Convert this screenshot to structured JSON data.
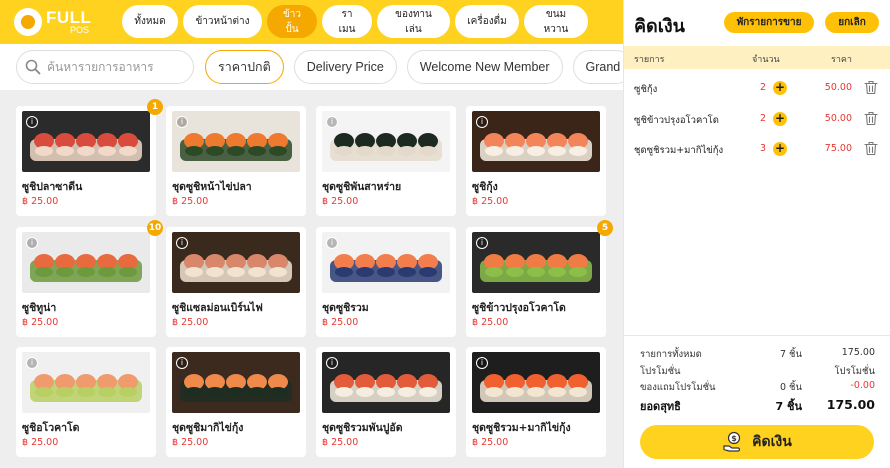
{
  "brand": {
    "name": "FULL",
    "sub": "POS"
  },
  "categories": [
    {
      "label": "ทั้งหมด",
      "active": false
    },
    {
      "label": "ข้าวหน้าต่าง",
      "active": false
    },
    {
      "label": "ข้าวปั้น",
      "active": true
    },
    {
      "label": "ราเมน",
      "active": false
    },
    {
      "label": "ของทานเล่น",
      "active": false
    },
    {
      "label": "เครื่องดื่ม",
      "active": false
    },
    {
      "label": "ขนมหวาน",
      "active": false
    }
  ],
  "search": {
    "placeholder": "ค้นหารายการอาหาร",
    "value": ""
  },
  "price_tabs": [
    {
      "label": "ราคาปกติ",
      "active": true
    },
    {
      "label": "Delivery Price",
      "active": false
    },
    {
      "label": "Welcome New Member",
      "active": false
    },
    {
      "label": "Grand",
      "active": false
    }
  ],
  "products": [
    {
      "name": "ซูชิปลาซาดีน",
      "price": "฿ 25.00",
      "badge": "1",
      "image": "sushi-sardine"
    },
    {
      "name": "ชุดซูชิหน้าไข่ปลา",
      "price": "฿ 25.00",
      "badge": "",
      "image": "sushi-roe"
    },
    {
      "name": "ชุดซูชิพันสาหร่าย",
      "price": "฿ 25.00",
      "badge": "",
      "image": "sushi-maki"
    },
    {
      "name": "ซูชิกุ้ง",
      "price": "฿ 25.00",
      "badge": "",
      "image": "sushi-shrimp"
    },
    {
      "name": "ซูชิทูน่า",
      "price": "฿ 25.00",
      "badge": "10",
      "image": "sushi-tuna"
    },
    {
      "name": "ซูชิแซลม่อนเบิร์นไฟ",
      "price": "฿ 25.00",
      "badge": "",
      "image": "sushi-salmon-seared"
    },
    {
      "name": "ชุดซูชิรวม",
      "price": "฿ 25.00",
      "badge": "",
      "image": "sushi-mixed"
    },
    {
      "name": "ซูชิข้าวปรุงอโวคาโด",
      "price": "฿ 25.00",
      "badge": "5",
      "image": "sushi-avocado-roll"
    },
    {
      "name": "ซูชิอโวคาโด",
      "price": "฿ 25.00",
      "badge": "",
      "image": "sushi-avocado"
    },
    {
      "name": "ชุดซูชิมากิไข่กุ้ง",
      "price": "฿ 25.00",
      "badge": "",
      "image": "sushi-maki-roe"
    },
    {
      "name": "ชุดซูชิรวมพันปูอัด",
      "price": "฿ 25.00",
      "badge": "",
      "image": "sushi-crab"
    },
    {
      "name": "ชุดซูชิรวม+มากิไข่กุ้ง",
      "price": "฿ 25.00",
      "badge": "",
      "image": "sushi-combo"
    }
  ],
  "order": {
    "title": "คิดเงิน",
    "hold_label": "พักรายการขาย",
    "cancel_label": "ยกเลิก",
    "col_item": "รายการ",
    "col_qty": "จำนวน",
    "col_price": "ราคา",
    "items": [
      {
        "name": "ซูชิกุ้ง",
        "qty": "2",
        "price": "50.00"
      },
      {
        "name": "ซูชิข้าวปรุงอโวคาโด",
        "qty": "2",
        "price": "50.00"
      },
      {
        "name": "ชุดซูชิรวม+มากิไข่กุ้ง",
        "qty": "3",
        "price": "75.00"
      }
    ],
    "summary": {
      "total_items_label": "รายการทั้งหมด",
      "total_items_qty": "7 ชิ้น",
      "total_items_amount": "175.00",
      "promo_label": "โปรโมชั่น",
      "promo_value": "โปรโมชั่น",
      "promo_gift_label": "ของแถมโปรโมชั่น",
      "promo_gift_qty": "0 ชิ้น",
      "promo_gift_amount": "-0.00",
      "net_label": "ยอดสุทธิ",
      "net_qty": "7 ชิ้น",
      "net_amount": "175.00"
    },
    "pay_label": "คิดเงิน"
  },
  "colors": {
    "brand_yellow": "#ffd220",
    "accent_orange": "#f5a800",
    "price_red": "#e53935"
  }
}
